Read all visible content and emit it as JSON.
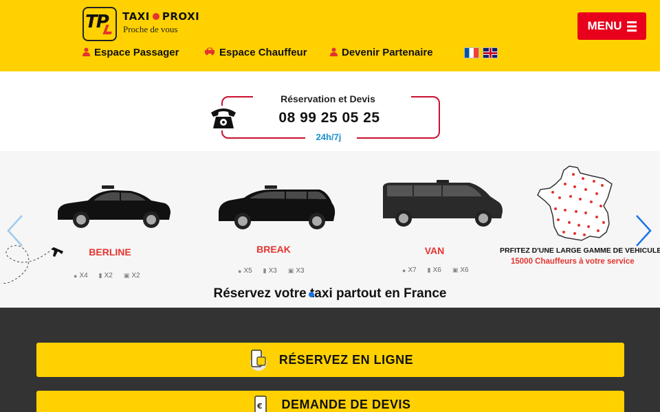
{
  "header": {
    "logo_text": "TP",
    "brand_part1": "TAXI",
    "brand_part2": "PROXI",
    "slogan": "Proche de vous",
    "menu_label": "MENU",
    "nav": [
      {
        "label": "Espace Passager",
        "icon": "user-icon"
      },
      {
        "label": "Espace Chauffeur",
        "icon": "car-icon"
      },
      {
        "label": "Devenir Partenaire",
        "icon": "user-icon"
      }
    ],
    "languages": [
      "fr",
      "en"
    ]
  },
  "contact": {
    "label": "Réservation et Devis",
    "phone": "08 99 25 05 25",
    "hours": "24h/7j"
  },
  "fleet": [
    {
      "label": "BERLINE",
      "passengers": "X4",
      "bags": "X2",
      "luggage": "X2"
    },
    {
      "label": "BREAK",
      "passengers": "X5",
      "bags": "X3",
      "luggage": "X3"
    },
    {
      "label": "VAN",
      "passengers": "X7",
      "bags": "X6",
      "luggage": "X6"
    }
  ],
  "promo": {
    "line1": "PRFITEZ D'UNE LARGE GAMME DE VEHICULES",
    "line2": "15000 Chauffeurs à votre service"
  },
  "tagline": "Réservez votre taxi partout en France",
  "cta": {
    "book": "RÉSERVEZ EN LIGNE",
    "quote": "DEMANDE DE DEVIS"
  },
  "colors": {
    "brand_yellow": "#ffd100",
    "accent_red": "#e8001c",
    "dark_bg": "#333333",
    "link_blue": "#1a8fd0"
  }
}
